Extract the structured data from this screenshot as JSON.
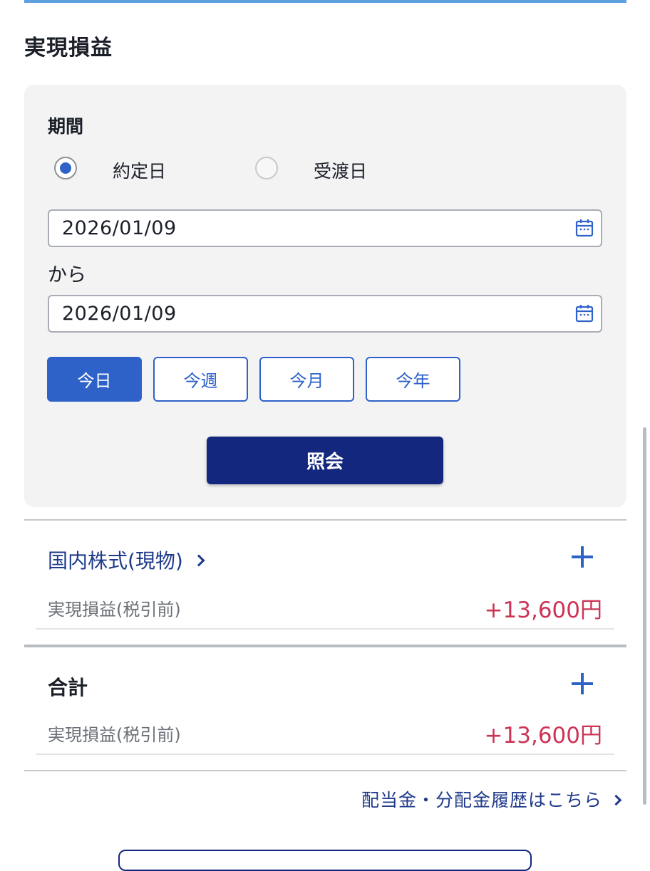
{
  "page": {
    "title": "実現損益"
  },
  "filter": {
    "period_label": "期間",
    "radio_options": [
      {
        "label": "約定日",
        "checked": true
      },
      {
        "label": "受渡日",
        "checked": false
      }
    ],
    "from_date": "2026/01/09",
    "separator": "から",
    "to_date": "2026/01/09",
    "quick_buttons": [
      {
        "label": "今日",
        "active": true
      },
      {
        "label": "今週",
        "active": false
      },
      {
        "label": "今月",
        "active": false
      },
      {
        "label": "今年",
        "active": false
      }
    ],
    "submit_label": "照会"
  },
  "domestic_stock": {
    "title": "国内株式(現物)",
    "row_label": "実現損益(税引前)",
    "row_value": "+13,600円"
  },
  "total": {
    "title": "合計",
    "row_label": "実現損益(税引前)",
    "row_value": "+13,600円"
  },
  "history_link": "配当金・分配金履歴はこちら",
  "colors": {
    "accent_blue": "#2f62c9",
    "navy": "#14277e",
    "profit_red": "#cc3456"
  }
}
